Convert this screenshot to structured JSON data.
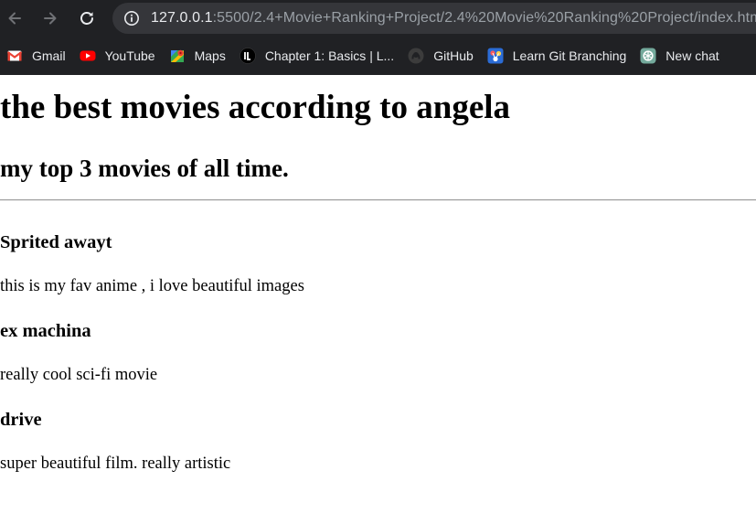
{
  "browser": {
    "url_host": "127.0.0.1",
    "url_path": ":5500/2.4+Movie+Ranking+Project/2.4%20Movie%20Ranking%20Project/index.html",
    "bookmarks": [
      {
        "label": "Gmail",
        "icon": "gmail-icon"
      },
      {
        "label": "YouTube",
        "icon": "youtube-icon"
      },
      {
        "label": "Maps",
        "icon": "maps-icon"
      },
      {
        "label": "Chapter 1: Basics | L...",
        "icon": "book-icon"
      },
      {
        "label": "GitHub",
        "icon": "github-icon"
      },
      {
        "label": "Learn Git Branching",
        "icon": "git-branching-icon"
      },
      {
        "label": "New chat",
        "icon": "chatgpt-icon"
      }
    ]
  },
  "page": {
    "title": "the best movies according to angela",
    "subtitle": "my top 3 movies of all time.",
    "movies": [
      {
        "title": "Sprited awayt",
        "description": "this is my fav anime , i love beautiful images"
      },
      {
        "title": "ex machina",
        "description": "really cool sci-fi movie"
      },
      {
        "title": "drive",
        "description": "super beautiful film. really artistic"
      }
    ]
  }
}
